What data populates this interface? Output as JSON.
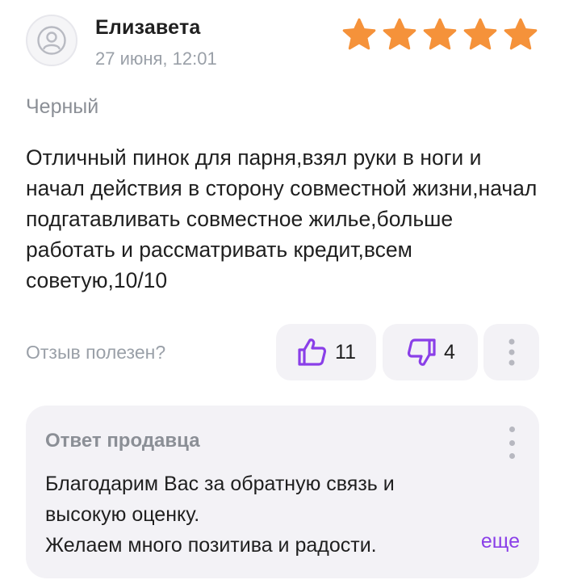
{
  "review": {
    "author": "Елизавета",
    "date": "27 июня, 12:01",
    "rating": 5,
    "rating_max": 5,
    "variant": "Черный",
    "text": "Отличный пинок для парня,взял руки в ноги и начал действия в сторону совместной жизни,начал подгатавливать совместное жилье,больше работать и рассматривать кредит,всем советую,10/10"
  },
  "helpful": {
    "label": "Отзыв полезен?",
    "likes": "11",
    "dislikes": "4"
  },
  "seller_reply": {
    "title": "Ответ продавца",
    "lines": [
      "Благодарим Вас за обратную связь и",
      "высокую оценку.",
      "Желаем много позитива и радости."
    ],
    "more_label": "еще"
  },
  "colors": {
    "star": "#f5923a",
    "accent": "#8a3fe8",
    "card_bg": "#f3f2f6",
    "muted_text": "#9aa0a8"
  },
  "icons": {
    "avatar": "user-icon",
    "star": "star-icon",
    "like": "thumbs-up-icon",
    "dislike": "thumbs-down-icon",
    "menu": "vertical-dots-icon"
  }
}
